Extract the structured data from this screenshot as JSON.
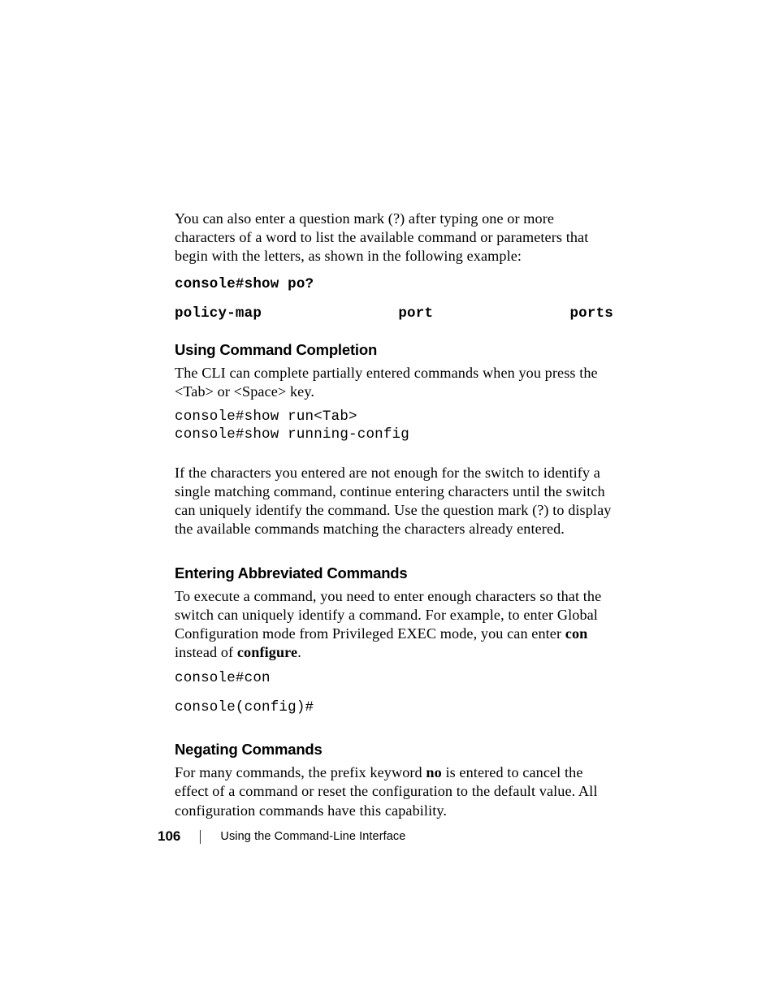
{
  "intro_para": "You can also enter a question mark (?) after typing one or more characters of a word to list the available command or parameters that begin with the letters, as shown in the following example:",
  "cmd_show_po": "console#show po?",
  "po_options": {
    "a": "policy-map",
    "b": "port",
    "c": "ports"
  },
  "section1": {
    "heading": "Using Command Completion",
    "para1": "The CLI can complete partially entered commands when you press the <Tab> or <Space> key.",
    "cmd_lines": "console#show run<Tab>\nconsole#show running-config",
    "para2": "If the characters you entered are not enough for the switch to identify a single matching command, continue entering characters until the switch can uniquely identify the command. Use the question mark (?) to display the available commands matching the characters already entered."
  },
  "section2": {
    "heading": "Entering Abbreviated Commands",
    "para1_pre": "To execute a command, you need to enter enough characters so that the switch can uniquely identify a command. For example, to enter Global Configuration mode from Privileged EXEC mode, you can enter ",
    "bold_con": "con",
    "para1_mid": " instead of ",
    "bold_configure": "configure",
    "para1_post": ".",
    "cmd1": "console#con",
    "cmd2": "console(config)#"
  },
  "section3": {
    "heading": "Negating Commands",
    "para1_pre": "For many commands, the prefix keyword ",
    "bold_no": "no",
    "para1_post": " is entered to cancel the effect of a command or reset the configuration to the default value. All configuration commands have this capability."
  },
  "footer": {
    "page_number": "106",
    "title": "Using the Command-Line Interface"
  }
}
